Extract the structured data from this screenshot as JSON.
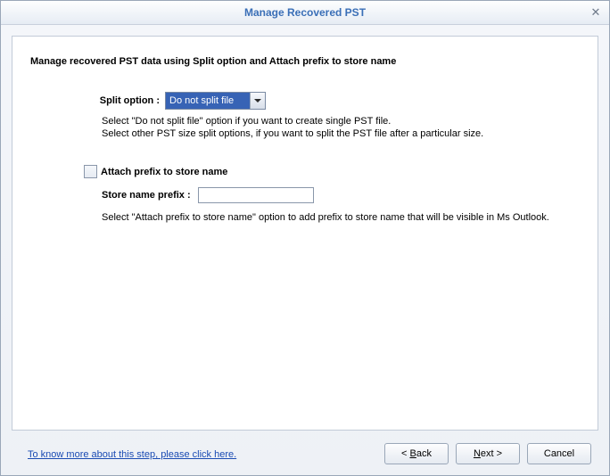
{
  "window": {
    "title": "Manage Recovered PST"
  },
  "heading": "Manage recovered PST data using Split option and Attach prefix to store name",
  "split": {
    "label": "Split option :",
    "selected": "Do not split file",
    "help_line1": "Select \"Do not split file\" option if you want to create single PST file.",
    "help_line2": "Select other PST size split options, if you want to split the PST file after a particular size."
  },
  "prefix": {
    "checkbox_label": "Attach prefix to store name",
    "checked": false,
    "input_label": "Store name prefix :",
    "input_value": "",
    "help": "Select \"Attach prefix to store name\" option to add prefix to store name that will be visible in Ms Outlook."
  },
  "footer_link": "To know more about this step, please click here.",
  "buttons": {
    "back_prefix": "< ",
    "back_letter": "B",
    "back_rest": "ack",
    "next_letter": "N",
    "next_rest": "ext >",
    "cancel": "Cancel"
  }
}
